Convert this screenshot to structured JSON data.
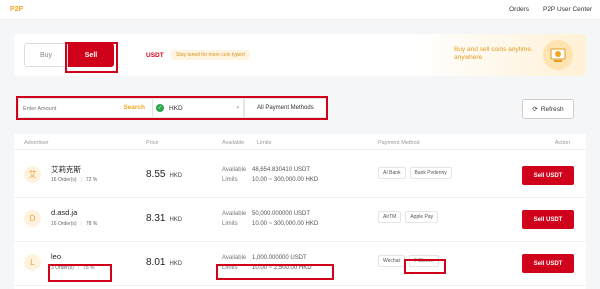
{
  "nav": {
    "brand": "P2P",
    "links": [
      "Orders",
      "P2P User Center"
    ]
  },
  "hero": {
    "tabs": {
      "buy": "Buy",
      "sell": "Sell"
    },
    "coin": "USDT",
    "tip": "Stay tuned for more coin types!",
    "promo": "Buy and sell coins anytime, anywhere"
  },
  "filters": {
    "amount_placeholder": "Enter Amount",
    "search_label": "Search",
    "currency": "HKD",
    "payment_methods": "All Payment Methods",
    "refresh_label": "Refresh"
  },
  "table": {
    "headers": {
      "advertiser": "Advertiser",
      "price": "Price",
      "available": "Available",
      "limits": "Limits",
      "payment": "Payment Method",
      "action": "Action"
    },
    "available_label": "Available",
    "limits_label": "Limits",
    "rows": [
      {
        "initial": "艾",
        "name": "艾莉克斯",
        "orders": "16 Order(s)",
        "rate": "72 %",
        "price": "8.55",
        "currency": "HKD",
        "available": "48,654.830410 USDT",
        "limits": "10.00 ~ 300,000.00 HKD",
        "methods": [
          "AI Bank",
          "Bank Pvdenny"
        ],
        "action": "Sell USDT"
      },
      {
        "initial": "D",
        "name": "d.asd.ja",
        "orders": "16 Order(s)",
        "rate": "78 %",
        "price": "8.31",
        "currency": "HKD",
        "available": "50,000.000000 USDT",
        "limits": "10.00 ~ 300,000.00 HKD",
        "methods": [
          "AirTM",
          "Apple Pay"
        ],
        "action": "Sell USDT"
      },
      {
        "initial": "L",
        "name": "leo",
        "orders": "3 Order(s)",
        "rate": "75 %",
        "price": "8.01",
        "currency": "HKD",
        "available": "1,000.000000 USDT",
        "limits": "10.00 ~ 2,500.00 HKD",
        "methods": [
          "Wechat",
          "7-Eleven"
        ],
        "action": "Sell USDT"
      }
    ]
  },
  "colors": {
    "accent": "#d0021b",
    "brand": "#f5a623"
  }
}
